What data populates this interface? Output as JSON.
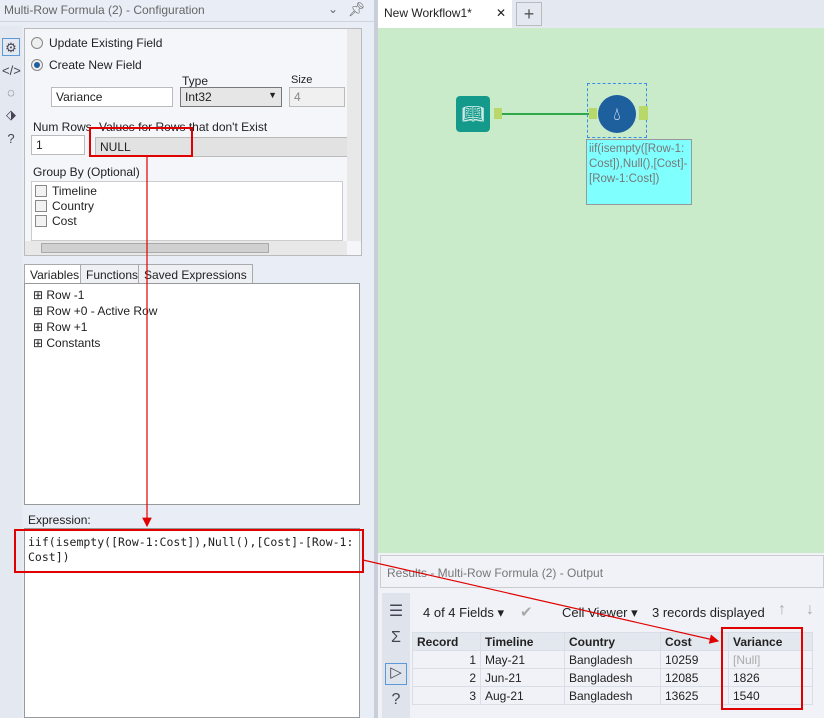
{
  "config": {
    "title": "Multi-Row Formula (2) - Configuration",
    "update_label": "Update Existing Field",
    "create_label": "Create New  Field",
    "field_name": "Variance",
    "type_label": "Type",
    "type_value": "Int32",
    "size_label": "Size",
    "size_value": "4",
    "num_rows_label": "Num Rows",
    "num_rows_value": "1",
    "values_label": "Values for Rows that don't Exist",
    "values_value": "NULL",
    "group_by_label": "Group By (Optional)",
    "group_fields": [
      "Timeline",
      "Country",
      "Cost"
    ],
    "tabs": [
      "Variables",
      "Functions",
      "Saved Expressions"
    ],
    "tree": [
      "Row -1",
      "Row +0 - Active Row",
      "Row +1",
      "Constants"
    ],
    "expression_label": "Expression:",
    "expression": "iif(isempty([Row-1:Cost]),Null(),[Cost]-[Row-1:Cost])"
  },
  "workflow": {
    "tab": "New Workflow1*",
    "annotation": "iif(isempty([Row-1:Cost]),Null(),[Cost]-[Row-1:Cost])"
  },
  "results": {
    "title": "Results - Multi-Row Formula (2) - Output",
    "fields": "4 of 4 Fields",
    "cell_viewer": "Cell Viewer",
    "records": "3 records displayed",
    "columns": [
      "Record",
      "Timeline",
      "Country",
      "Cost",
      "Variance"
    ],
    "rows": [
      [
        "1",
        "May-21",
        "Bangladesh",
        "10259",
        "[Null]"
      ],
      [
        "2",
        "Jun-21",
        "Bangladesh",
        "12085",
        "1826"
      ],
      [
        "3",
        "Aug-21",
        "Bangladesh",
        "13625",
        "1540"
      ]
    ]
  },
  "colors": {
    "canvas": "#c9ebca",
    "annotation": "#e00000",
    "tool": "#1e5f9e"
  }
}
